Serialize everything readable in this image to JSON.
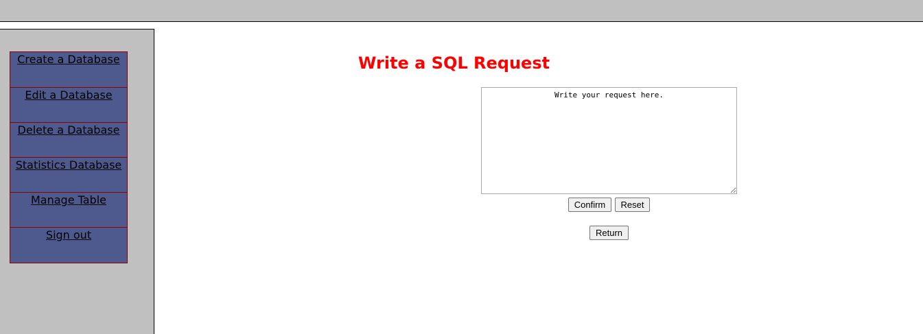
{
  "sidebar": {
    "items": [
      {
        "label": "Create a Database"
      },
      {
        "label": "Edit a Database"
      },
      {
        "label": "Delete a Database"
      },
      {
        "label": "Statistics Database"
      },
      {
        "label": "Manage Table"
      },
      {
        "label": "Sign out"
      }
    ]
  },
  "main": {
    "title": "Write a SQL Request",
    "request_placeholder": "Write your request here.",
    "confirm_label": "Confirm",
    "reset_label": "Reset",
    "return_label": "Return"
  },
  "colors": {
    "title": "#ff0000",
    "menu_item_bg": "#4e5a8e",
    "menu_item_border": "#8b0000",
    "sidebar_bg": "#c0c0c0",
    "topbar_bg": "#c0c0c0"
  }
}
